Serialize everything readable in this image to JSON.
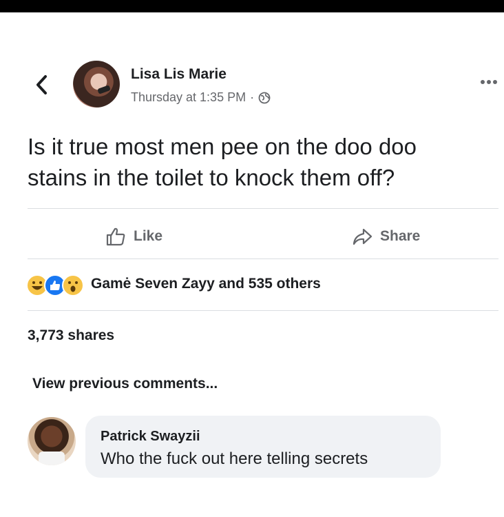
{
  "post": {
    "author": "Lisa Lis Marie",
    "timestamp": "Thursday at 1:35 PM",
    "separator": "·",
    "privacy_icon": "globe-icon",
    "text_line1": "Is it true most men pee on the doo doo",
    "text_line2": "stains in the toilet to knock them off?"
  },
  "actions": {
    "like_label": "Like",
    "share_label": "Share"
  },
  "reactions": {
    "icons": [
      "haha-reaction-icon",
      "like-reaction-icon",
      "wow-reaction-icon"
    ],
    "summary": "Gamė Seven Zayy and 535 others"
  },
  "stats": {
    "shares": "3,773 shares"
  },
  "comments": {
    "view_previous": "View previous comments...",
    "items": [
      {
        "author": "Patrick Swayzii",
        "text": "Who the fuck out here telling secrets"
      }
    ]
  },
  "colors": {
    "text": "#1c1e21",
    "secondary": "#65676b",
    "divider": "#dadde1",
    "bubble": "#f0f2f5",
    "like_blue": "#1877f2",
    "reaction_yellow": "#f7c447"
  }
}
